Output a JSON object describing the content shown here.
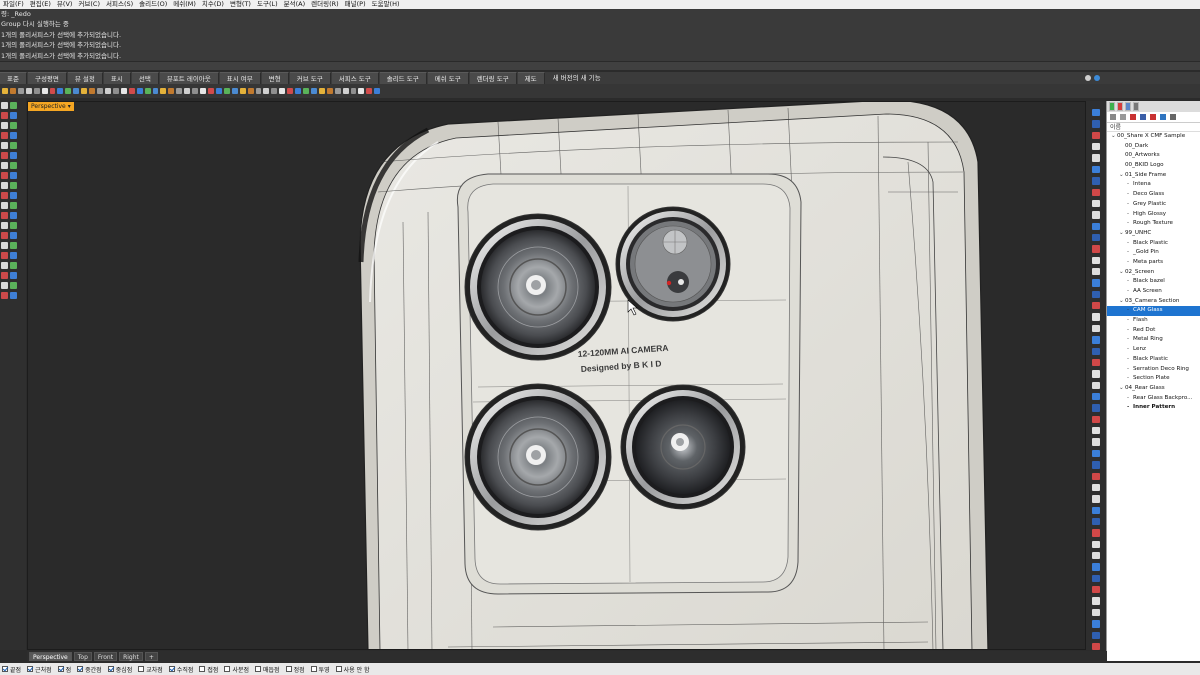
{
  "menu": [
    "파일(F)",
    "편집(E)",
    "뷰(V)",
    "커브(C)",
    "서피스(S)",
    "솔리드(O)",
    "메쉬(M)",
    "치수(D)",
    "변형(T)",
    "도구(L)",
    "분석(A)",
    "렌더링(R)",
    "패널(P)",
    "도움말(H)"
  ],
  "history": [
    "령: _Redo",
    "Group 다시 실행하는 중",
    "1개의 폴리서피스가 선택에 추가되었습니다.",
    "1개의 폴리서피스가 선택에 추가되었습니다.",
    "1개의 폴리서피스가 선택에 추가되었습니다."
  ],
  "tabs": [
    "표준",
    "구성평면",
    "뷰 설정",
    "표시",
    "선택",
    "뷰포트 레이아웃",
    "표시 여부",
    "변형",
    "커브 도구",
    "서피스 도구",
    "솔리드 도구",
    "메쉬 도구",
    "렌더링 도구",
    "제도",
    "새 버전의 새 기능"
  ],
  "viewport": {
    "label": "Perspective",
    "engraving_line1": "12-120MM AI CAMERA",
    "engraving_line2": "Designed by B K I D"
  },
  "viewport_tabs": [
    "Perspective",
    "Top",
    "Front",
    "Right"
  ],
  "viewport_tab_add": "+",
  "panel": {
    "header": "이름",
    "layers": [
      {
        "name": "00_Share X CMF Sample",
        "depth": 0,
        "caret": "v"
      },
      {
        "name": "00_Dark",
        "depth": 1,
        "caret": ""
      },
      {
        "name": "00_Artworks",
        "depth": 1,
        "caret": ""
      },
      {
        "name": "00_BKID Logo",
        "depth": 1,
        "caret": ""
      },
      {
        "name": "01_Side Frame",
        "depth": 1,
        "caret": "v"
      },
      {
        "name": "Intena",
        "depth": 2,
        "caret": ""
      },
      {
        "name": "Deco Glass",
        "depth": 2,
        "caret": ""
      },
      {
        "name": "Grey Plastic",
        "depth": 2,
        "caret": ""
      },
      {
        "name": "High Glossy",
        "depth": 2,
        "caret": ""
      },
      {
        "name": "Rough Texture",
        "depth": 2,
        "caret": ""
      },
      {
        "name": "99_UNHC",
        "depth": 1,
        "caret": "v"
      },
      {
        "name": "Black Plastic",
        "depth": 2,
        "caret": ""
      },
      {
        "name": "_Gold Pin",
        "depth": 2,
        "caret": ""
      },
      {
        "name": "Meta parts",
        "depth": 2,
        "caret": ""
      },
      {
        "name": "02_Screen",
        "depth": 1,
        "caret": "v"
      },
      {
        "name": "Black bazel",
        "depth": 2,
        "caret": ""
      },
      {
        "name": "AA Screen",
        "depth": 2,
        "caret": ""
      },
      {
        "name": "03_Camera Section",
        "depth": 1,
        "caret": "v"
      },
      {
        "name": "CAM Glass",
        "depth": 2,
        "caret": "",
        "selected": true
      },
      {
        "name": "Flash",
        "depth": 2,
        "caret": ""
      },
      {
        "name": "Red Dot",
        "depth": 2,
        "caret": ""
      },
      {
        "name": "Metal Ring",
        "depth": 2,
        "caret": ""
      },
      {
        "name": "Lenz",
        "depth": 2,
        "caret": ""
      },
      {
        "name": "Black Plastic",
        "depth": 2,
        "caret": ""
      },
      {
        "name": "Serration Deco Ring",
        "depth": 2,
        "caret": ""
      },
      {
        "name": "Section Plate",
        "depth": 2,
        "caret": ""
      },
      {
        "name": "04_Rear Glass",
        "depth": 1,
        "caret": "v"
      },
      {
        "name": "Rear Glass Backpro...",
        "depth": 2,
        "caret": ""
      },
      {
        "name": "Inner Pattern",
        "depth": 2,
        "caret": "",
        "bold": true
      }
    ]
  },
  "osnap": [
    {
      "label": "끝점",
      "on": true
    },
    {
      "label": "근처점",
      "on": true
    },
    {
      "label": "점",
      "on": true
    },
    {
      "label": "중간점",
      "on": true
    },
    {
      "label": "중심점",
      "on": true
    },
    {
      "label": "교차점",
      "on": false
    },
    {
      "label": "수직점",
      "on": true
    },
    {
      "label": "접점",
      "on": false
    },
    {
      "label": "사분점",
      "on": false
    },
    {
      "label": "매듭점",
      "on": false
    },
    {
      "label": "정점",
      "on": false
    },
    {
      "label": "투영",
      "on": false
    },
    {
      "label": "사용 안 함",
      "on": false
    }
  ],
  "colors": {
    "viewport_bg": "#2a2a2a",
    "body": "#e4e2dc",
    "label_accent": "#f5a623",
    "selection": "#1e74d0"
  }
}
